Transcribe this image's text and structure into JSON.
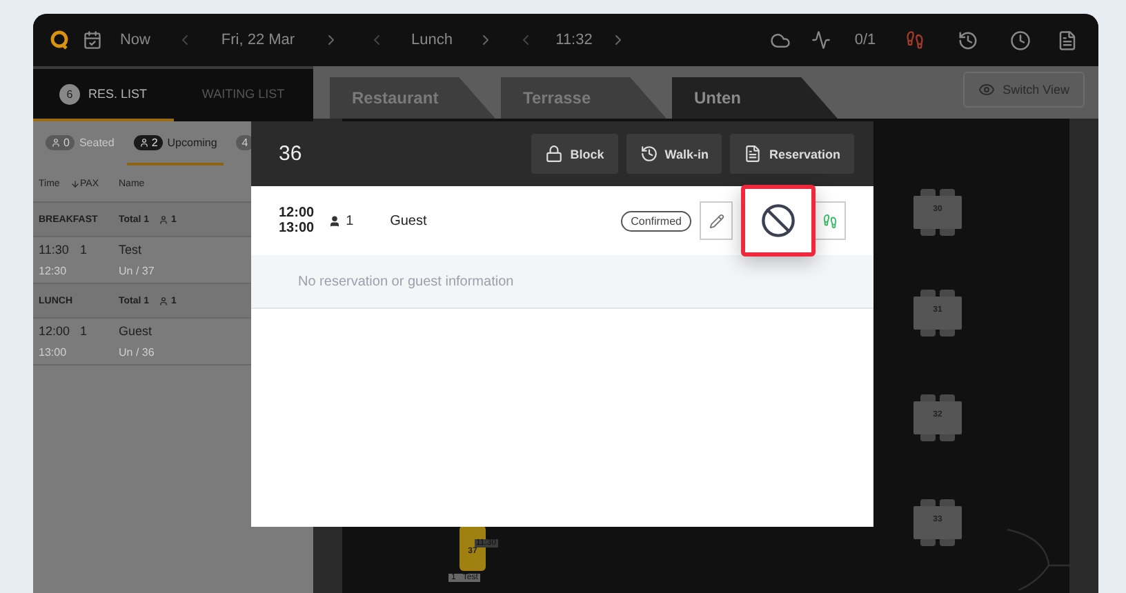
{
  "top_bar": {
    "now_label": "Now",
    "date": "Fri, 22 Mar",
    "meal": "Lunch",
    "time": "11:32",
    "counter": "0/1"
  },
  "list_tabs": [
    {
      "label": "RES. LIST",
      "count": "6",
      "selected": true
    },
    {
      "label": "WAITING LIST",
      "selected": false
    }
  ],
  "filters": [
    {
      "count": "0",
      "label": "Seated",
      "selected": false
    },
    {
      "count": "2",
      "label": "Upcoming",
      "selected": true
    },
    {
      "count": "4",
      "selected": false
    }
  ],
  "columns": [
    "Time",
    "PAX",
    "Name"
  ],
  "groups": [
    {
      "name": "BREAKFAST",
      "total": "Total 1",
      "pax": "1",
      "rows": [
        {
          "start": "11:30",
          "pax": "1",
          "name": "Test",
          "end": "12:30",
          "table": "Un / 37"
        }
      ]
    },
    {
      "name": "LUNCH",
      "total": "Total 1",
      "pax": "1",
      "rows": [
        {
          "start": "12:00",
          "pax": "1",
          "name": "Guest",
          "end": "13:00",
          "table": "Un / 36"
        }
      ]
    }
  ],
  "floor_tabs": [
    {
      "label": "Restaurant",
      "selected": false
    },
    {
      "label": "Terrasse",
      "selected": false
    },
    {
      "label": "Unten",
      "selected": true
    }
  ],
  "switch_view": "Switch View",
  "tables": [
    {
      "number": "30"
    },
    {
      "number": "31"
    },
    {
      "number": "32"
    },
    {
      "number": "33"
    },
    {
      "number": "37",
      "occupied": true,
      "time": "11:30",
      "guest_pax": "1",
      "guest": "Test"
    }
  ],
  "modal": {
    "title": "36",
    "actions": [
      "Block",
      "Walk-in",
      "Reservation"
    ],
    "reservation": {
      "start": "12:00",
      "end": "13:00",
      "pax": "1",
      "name": "Guest",
      "status": "Confirmed"
    },
    "info": "No reservation or guest information"
  }
}
